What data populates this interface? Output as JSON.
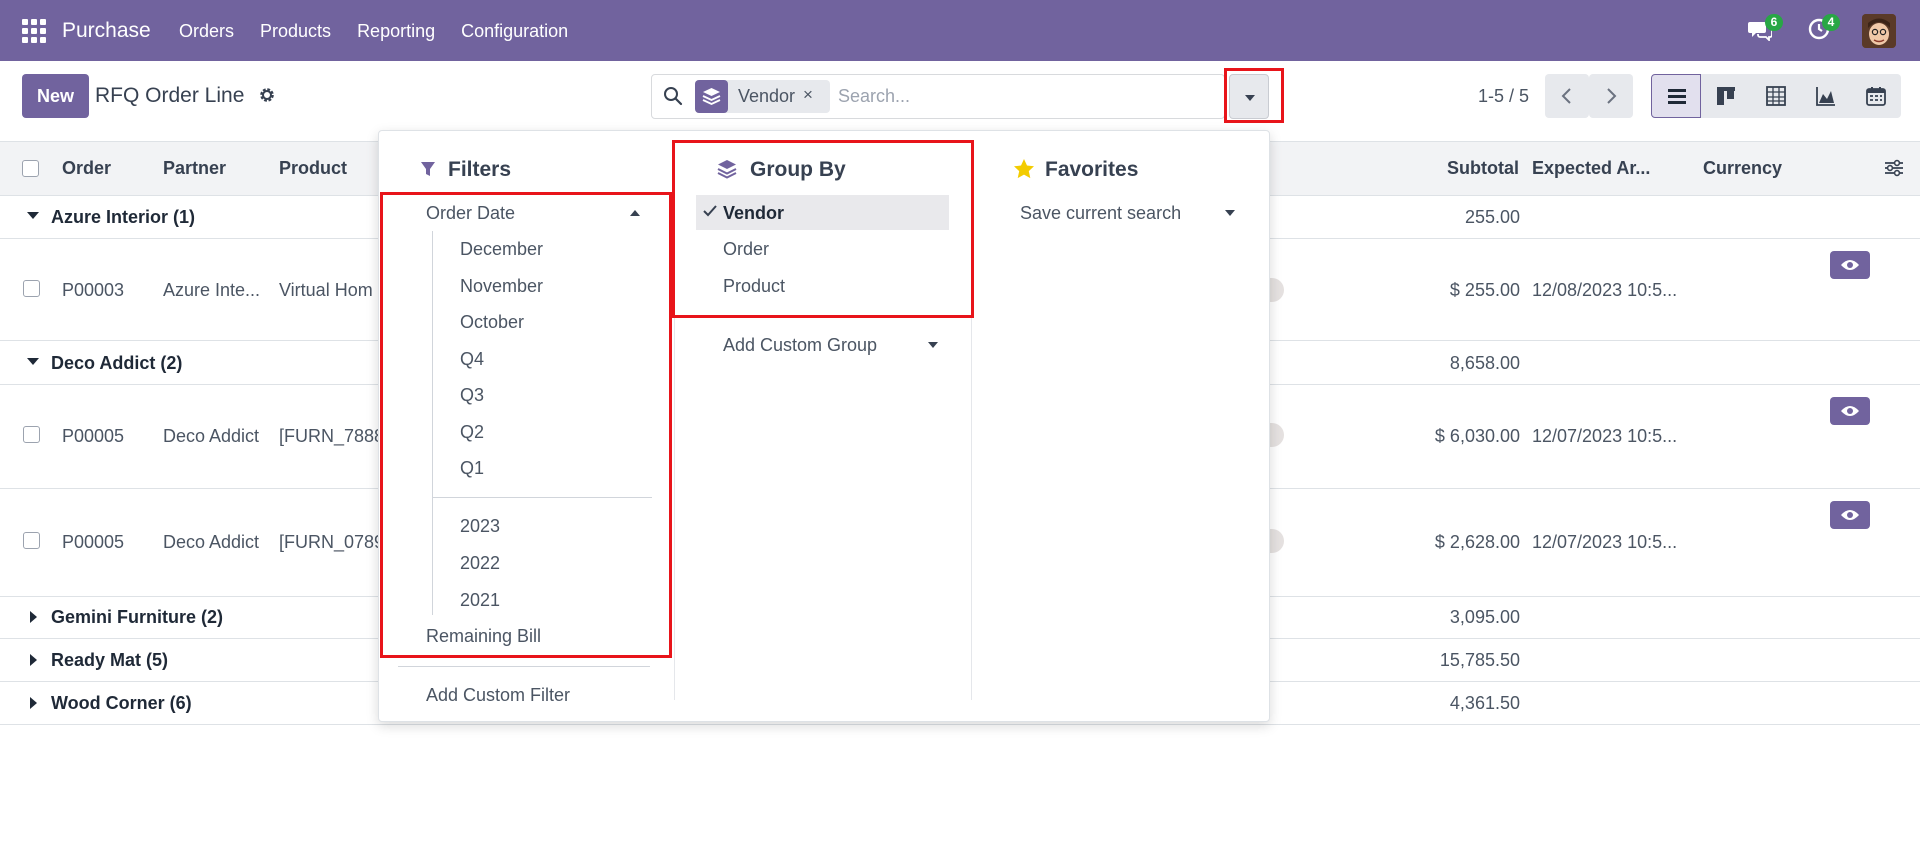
{
  "navbar": {
    "brand": "Purchase",
    "menu": [
      "Orders",
      "Products",
      "Reporting",
      "Configuration"
    ],
    "messages_count": "6",
    "activities_count": "4",
    "color": "#71639e"
  },
  "control_panel": {
    "new_label": "New",
    "title": "RFQ Order Line",
    "search": {
      "facet_value": "Vendor",
      "facet_remove": "×",
      "placeholder": "Search..."
    },
    "pager": "1-5 / 5",
    "views": [
      "list-icon",
      "kanban-icon",
      "pivot-icon",
      "graph-icon",
      "calendar-icon"
    ]
  },
  "table": {
    "headers": {
      "order": "Order",
      "partner": "Partner",
      "product": "Product",
      "subtotal": "Subtotal",
      "expected_arrival": "Expected Ar...",
      "currency": "Currency"
    },
    "groups": [
      {
        "label": "Azure Interior (1)",
        "subtotal": "255.00",
        "expanded": true
      },
      {
        "label": "Deco Addict (2)",
        "subtotal": "8,658.00",
        "expanded": true
      },
      {
        "label": "Gemini Furniture (2)",
        "subtotal": "3,095.00",
        "expanded": false
      },
      {
        "label": "Ready Mat (5)",
        "subtotal": "15,785.50",
        "expanded": false
      },
      {
        "label": "Wood Corner (6)",
        "subtotal": "4,361.50",
        "expanded": false
      }
    ],
    "rows": [
      {
        "order": "P00003",
        "partner": "Azure Inte...",
        "product": "Virtual Hom",
        "subtotal": "$ 255.00",
        "expected": "12/08/2023 10:5..."
      },
      {
        "order": "P00005",
        "partner": "Deco Addict",
        "product": "[FURN_7888",
        "subtotal": "$ 6,030.00",
        "expected": "12/07/2023 10:5..."
      },
      {
        "order": "P00005",
        "partner": "Deco Addict",
        "product": "[FURN_0789",
        "subtotal": "$ 2,628.00",
        "expected": "12/07/2023 10:5..."
      }
    ]
  },
  "dropdown": {
    "filters": {
      "heading": "Filters",
      "order_date": "Order Date",
      "months": [
        "December",
        "November",
        "October"
      ],
      "quarters": [
        "Q4",
        "Q3",
        "Q2",
        "Q1"
      ],
      "years": [
        "2023",
        "2022",
        "2021"
      ],
      "remaining_bill": "Remaining Bill",
      "add_custom_filter": "Add Custom Filter"
    },
    "group_by": {
      "heading": "Group By",
      "items": [
        "Vendor",
        "Order",
        "Product"
      ],
      "selected": "Vendor",
      "add_custom_group": "Add Custom Group"
    },
    "favorites": {
      "heading": "Favorites",
      "save_current_search": "Save current search"
    }
  },
  "colors": {
    "highlight": "#e8141a",
    "star": "#f3cc00"
  }
}
